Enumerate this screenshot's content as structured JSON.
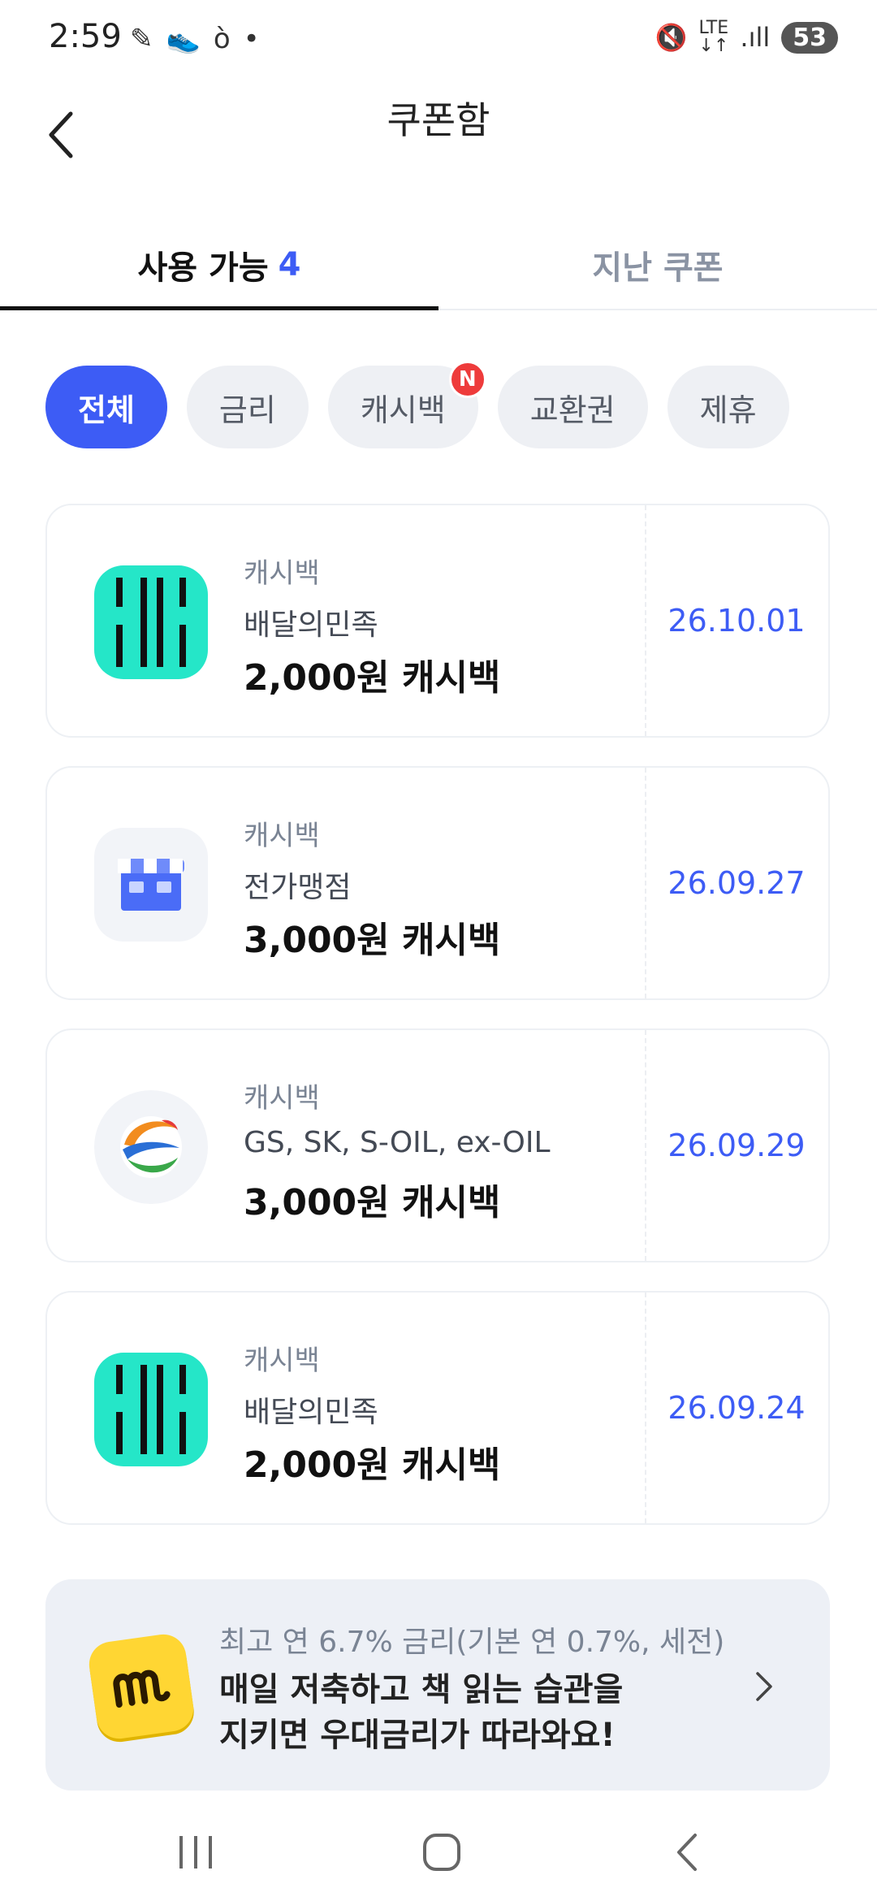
{
  "status_bar": {
    "time": "2:59",
    "battery": "53"
  },
  "header": {
    "title": "쿠폰함"
  },
  "tabs": {
    "available_label": "사용 가능",
    "available_count": "4",
    "past_label": "지난 쿠폰"
  },
  "filters": [
    {
      "label": "전체",
      "active": true
    },
    {
      "label": "금리",
      "active": false
    },
    {
      "label": "캐시백",
      "active": false,
      "badge": "N"
    },
    {
      "label": "교환권",
      "active": false
    },
    {
      "label": "제휴",
      "active": false
    }
  ],
  "coupons": [
    {
      "type": "캐시백",
      "merchant": "배달의민족",
      "amount": "2,000원 캐시백",
      "date": "26.10.01",
      "logo": "baemin-logo-icon"
    },
    {
      "type": "캐시백",
      "merchant": "전가맹점",
      "amount": "3,000원 캐시백",
      "date": "26.09.27",
      "logo": "store-icon"
    },
    {
      "type": "캐시백",
      "merchant": "GS, SK, S-OIL, ex-OIL",
      "amount": "3,000원 캐시백",
      "date": "26.09.29",
      "logo": "oil-station-icon"
    },
    {
      "type": "캐시백",
      "merchant": "배달의민족",
      "amount": "2,000원 캐시백",
      "date": "26.09.24",
      "logo": "baemin-logo-icon"
    }
  ],
  "promo": {
    "subtitle": "최고 연 6.7% 금리(기본 연 0.7%, 세전)",
    "line1": "매일 저축하고 책 읽는 습관을",
    "line2": "지키면 우대금리가 따라와요!"
  },
  "colors": {
    "accent": "#3d5cf5",
    "badge": "#ee3b3b",
    "baemin": "#25e6c8"
  }
}
